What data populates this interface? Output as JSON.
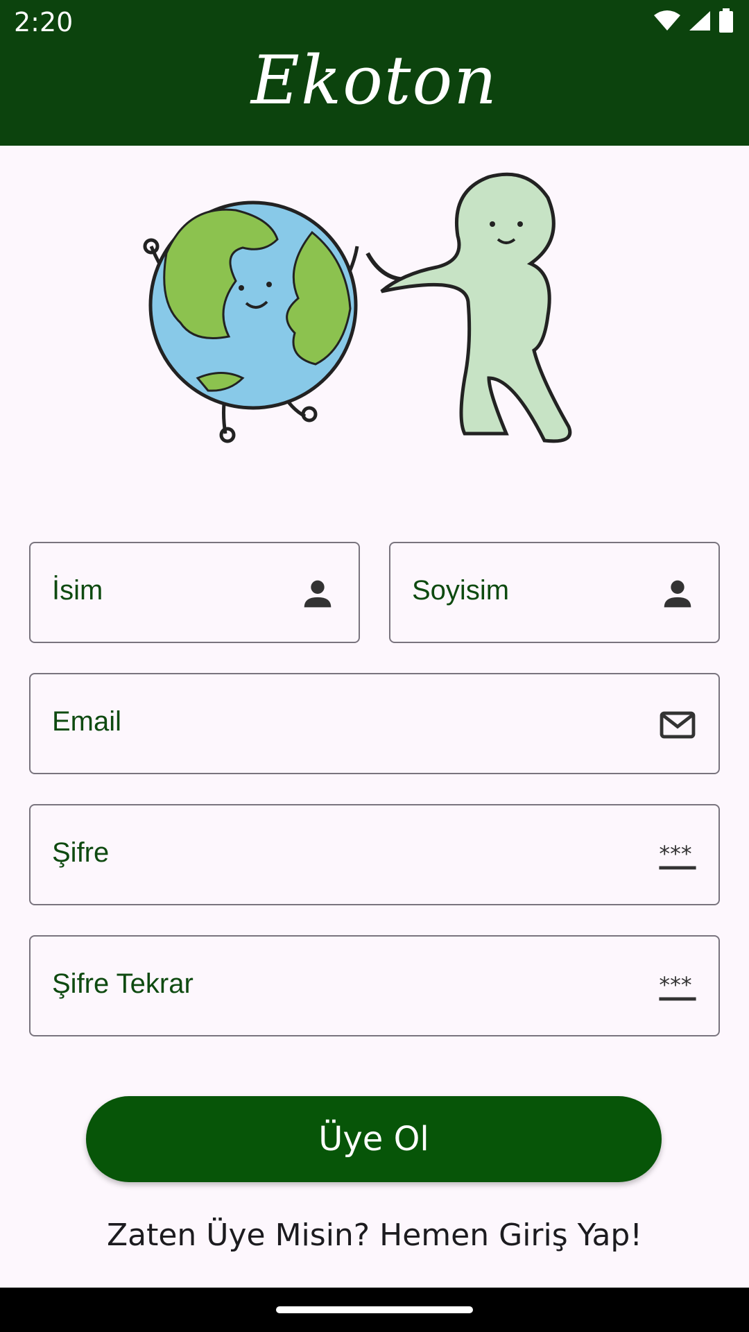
{
  "status_bar": {
    "time": "2:20"
  },
  "header": {
    "title": "Ekoton"
  },
  "form": {
    "first_name_label": "İsim",
    "last_name_label": "Soyisim",
    "email_label": "Email",
    "password_label": "Şifre",
    "password_repeat_label": "Şifre Tekrar"
  },
  "actions": {
    "signup_button": "Üye Ol",
    "login_link": "Zaten Üye Misin? Hemen Giriş Yap!"
  },
  "icons": {
    "first_name": "person-icon",
    "last_name": "person-icon",
    "email": "mail-icon",
    "password": "password-icon",
    "password_repeat": "password-icon"
  },
  "colors": {
    "header": "#0c430d",
    "button": "#075508",
    "label": "#0e4a10",
    "background": "#fdf7fd"
  }
}
